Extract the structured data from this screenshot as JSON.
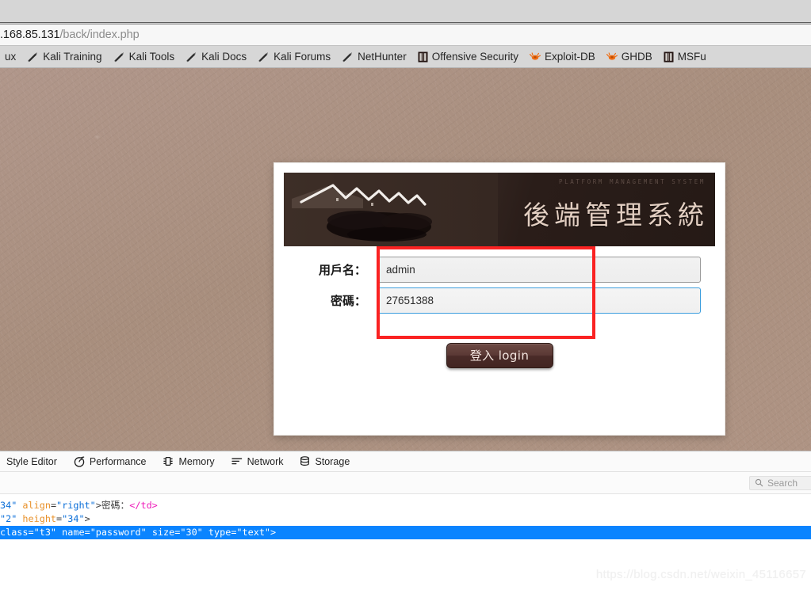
{
  "browser": {
    "url": {
      "host": ".168.85.131",
      "path": "/back/index.php"
    },
    "bookmarks": [
      {
        "label": "ux",
        "icon": "none"
      },
      {
        "label": "Kali Training",
        "icon": "dragon-icon"
      },
      {
        "label": "Kali Tools",
        "icon": "dragon-icon"
      },
      {
        "label": "Kali Docs",
        "icon": "dragon-icon"
      },
      {
        "label": "Kali Forums",
        "icon": "dragon-icon"
      },
      {
        "label": "NetHunter",
        "icon": "dragon-icon"
      },
      {
        "label": "Offensive Security",
        "icon": "shield-icon"
      },
      {
        "label": "Exploit-DB",
        "icon": "bug-icon"
      },
      {
        "label": "GHDB",
        "icon": "bug-icon"
      },
      {
        "label": "MSFu",
        "icon": "shield-icon"
      }
    ]
  },
  "login": {
    "banner_title": "後端管理系統",
    "banner_subtitle": "PLATFORM MANAGEMENT SYSTEM",
    "fields": [
      {
        "label": "用戶名：",
        "value": "admin",
        "name": "username",
        "focused": false
      },
      {
        "label": "密碼：",
        "value": "27651388",
        "name": "password",
        "focused": true
      }
    ],
    "submit_label": "登入 login",
    "highlight_color": "#fa2222"
  },
  "devtools": {
    "tabs": [
      {
        "label": "Style Editor",
        "icon": "none"
      },
      {
        "label": "Performance",
        "icon": "stopwatch-icon"
      },
      {
        "label": "Memory",
        "icon": "memory-chip-icon"
      },
      {
        "label": "Network",
        "icon": "network-lines-icon"
      },
      {
        "label": "Storage",
        "icon": "database-icon"
      }
    ],
    "search_placeholder": "Search",
    "markup_lines": [
      {
        "selected": false,
        "tokens": [
          {
            "t": "val",
            "s": "34\""
          },
          {
            "t": "txt",
            "s": " "
          },
          {
            "t": "attr",
            "s": "align"
          },
          {
            "t": "txt",
            "s": "="
          },
          {
            "t": "val",
            "s": "\"right\""
          },
          {
            "t": "txt",
            "s": ">密碼："
          },
          {
            "t": "tag",
            "s": "</td>"
          }
        ]
      },
      {
        "selected": false,
        "tokens": [
          {
            "t": "val",
            "s": "\"2\""
          },
          {
            "t": "txt",
            "s": " "
          },
          {
            "t": "attr",
            "s": "height"
          },
          {
            "t": "txt",
            "s": "="
          },
          {
            "t": "val",
            "s": "\"34\""
          },
          {
            "t": "txt",
            "s": ">"
          }
        ]
      },
      {
        "selected": true,
        "tokens": [
          {
            "t": "attr",
            "s": "class"
          },
          {
            "t": "txt",
            "s": "="
          },
          {
            "t": "val",
            "s": "\"t3\""
          },
          {
            "t": "txt",
            "s": " "
          },
          {
            "t": "attr",
            "s": "name"
          },
          {
            "t": "txt",
            "s": "="
          },
          {
            "t": "val",
            "s": "\"password\""
          },
          {
            "t": "txt",
            "s": " "
          },
          {
            "t": "attr",
            "s": "size"
          },
          {
            "t": "txt",
            "s": "="
          },
          {
            "t": "val",
            "s": "\"30\""
          },
          {
            "t": "txt",
            "s": " "
          },
          {
            "t": "attr",
            "s": "type"
          },
          {
            "t": "txt",
            "s": "="
          },
          {
            "t": "val",
            "s": "\"text\""
          },
          {
            "t": "txt",
            "s": ">"
          }
        ]
      }
    ]
  },
  "watermark": "https://blog.csdn.net/weixin_45116657"
}
